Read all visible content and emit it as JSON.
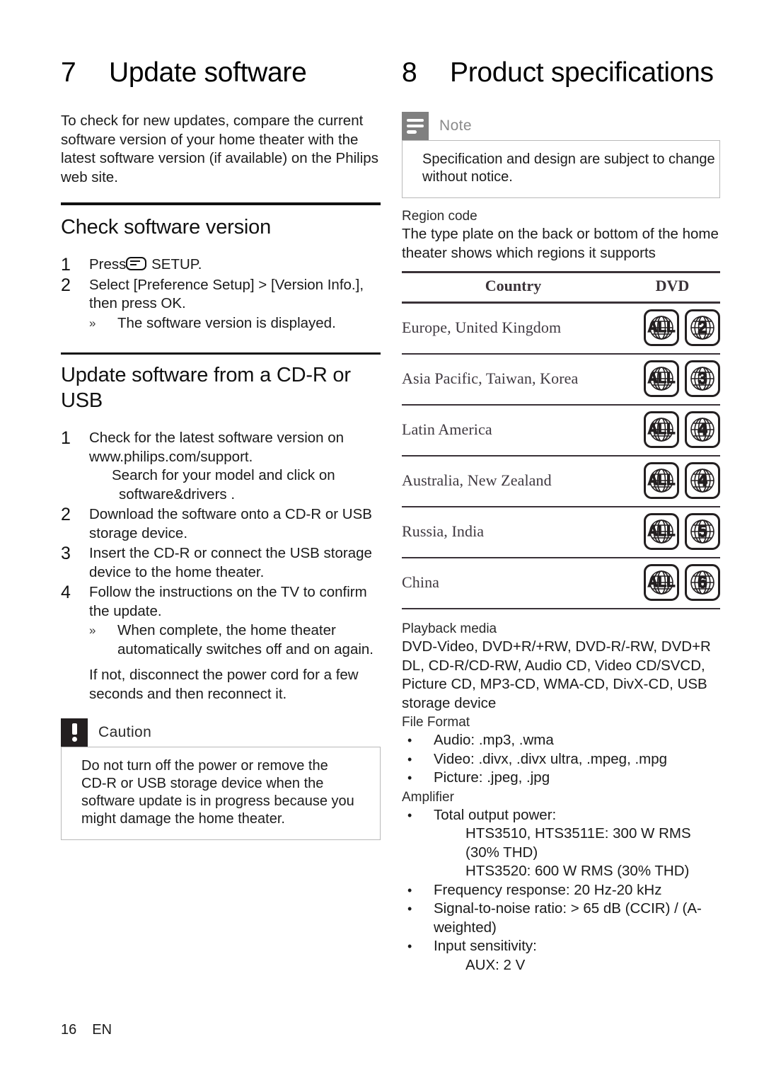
{
  "document": {
    "footer": {
      "page_number": "16",
      "language": "EN"
    }
  },
  "left_column": {
    "chapter": {
      "number": "7",
      "title": "Update software"
    },
    "intro": "To check for new updates, compare the current software version of your home theater with the latest software version (if available) on the Philips web site.",
    "section1": {
      "heading": "Check software version",
      "steps": [
        {
          "index": "1",
          "text_before_icon": "Press",
          "icon": "setup-button-icon",
          "text_after_icon": " SETUP."
        },
        {
          "index": "2",
          "line1": "Select [Preference Setup] > [Version Info.],",
          "line2": "then press OK.",
          "substep_marker": "»",
          "substep_text": "The software version is displayed."
        }
      ]
    },
    "section2": {
      "heading": "Update software from a CD-R or USB",
      "steps": [
        {
          "index": "1",
          "text": "Check for the latest software version on www.philips.com/support.",
          "note_line1": "Search for your model and click on",
          "note_line2": "software&drivers ."
        },
        {
          "index": "2",
          "text": "Download the software onto a CD-R or USB storage device."
        },
        {
          "index": "3",
          "text": "Insert the CD-R or connect the USB storage device to the home theater."
        },
        {
          "index": "4",
          "text": "Follow the instructions on the TV to confirm the update.",
          "substep_marker": "»",
          "substep_text": "When complete, the home theater automatically switches off and on again."
        }
      ],
      "closing": "If not, disconnect the power cord for a few seconds and then reconnect it."
    },
    "caution": {
      "icon": "exclamation-icon",
      "label": "Caution",
      "badge_color": "#231f20",
      "lines": [
        "Do not turn off the power or remove the",
        "CD-R or USB storage device when the",
        "software update is in progress because you",
        "might damage the home theater."
      ]
    }
  },
  "right_column": {
    "chapter": {
      "number": "8",
      "title": "Product specifications"
    },
    "note": {
      "icon": "note-lines-icon",
      "label": "Note",
      "badge_color": "#808080",
      "lines": [
        "Specification and design are subject to change",
        "without notice."
      ]
    },
    "region_code": {
      "label": "Region code",
      "description": "The type plate on the back or bottom of the home theater shows which regions it supports",
      "table": {
        "headers": [
          "Country",
          "DVD"
        ],
        "rows": [
          {
            "country": "Europe, United Kingdom",
            "dvd": [
              "ALL",
              "2"
            ]
          },
          {
            "country": "Asia Pacific, Taiwan, Korea",
            "dvd": [
              "ALL",
              "3"
            ]
          },
          {
            "country": "Latin America",
            "dvd": [
              "ALL",
              "4"
            ]
          },
          {
            "country": "Australia, New Zealand",
            "dvd": [
              "ALL",
              "4"
            ]
          },
          {
            "country": "Russia, India",
            "dvd": [
              "ALL",
              "5"
            ]
          },
          {
            "country": "China",
            "dvd": [
              "ALL",
              "6"
            ]
          }
        ]
      }
    },
    "playback_media": {
      "label": "Playback media",
      "value": "DVD-Video, DVD+R/+RW, DVD-R/-RW, DVD+R DL, CD-R/CD-RW, Audio CD, Video CD/SVCD, Picture CD, MP3-CD, WMA-CD, DivX-CD, USB storage device"
    },
    "file_format": {
      "label": "File Format",
      "items": [
        "Audio: .mp3, .wma",
        "Video: .divx, .divx ultra, .mpeg, .mpg",
        "Picture: .jpeg, .jpg"
      ]
    },
    "amplifier": {
      "label": "Amplifier",
      "items": [
        {
          "text": "Total output power:",
          "sub_lines": [
            "HTS3510, HTS3511E: 300 W RMS",
            "(30% THD)",
            "HTS3520: 600 W RMS (30% THD)"
          ]
        },
        {
          "text": "Frequency response: 20 Hz-20 kHz"
        },
        {
          "text": "Signal-to-noise ratio: > 65 dB (CCIR) / (A-weighted)"
        },
        {
          "text": "Input sensitivity:",
          "sub_lines": [
            "AUX: 2 V"
          ]
        }
      ]
    }
  }
}
